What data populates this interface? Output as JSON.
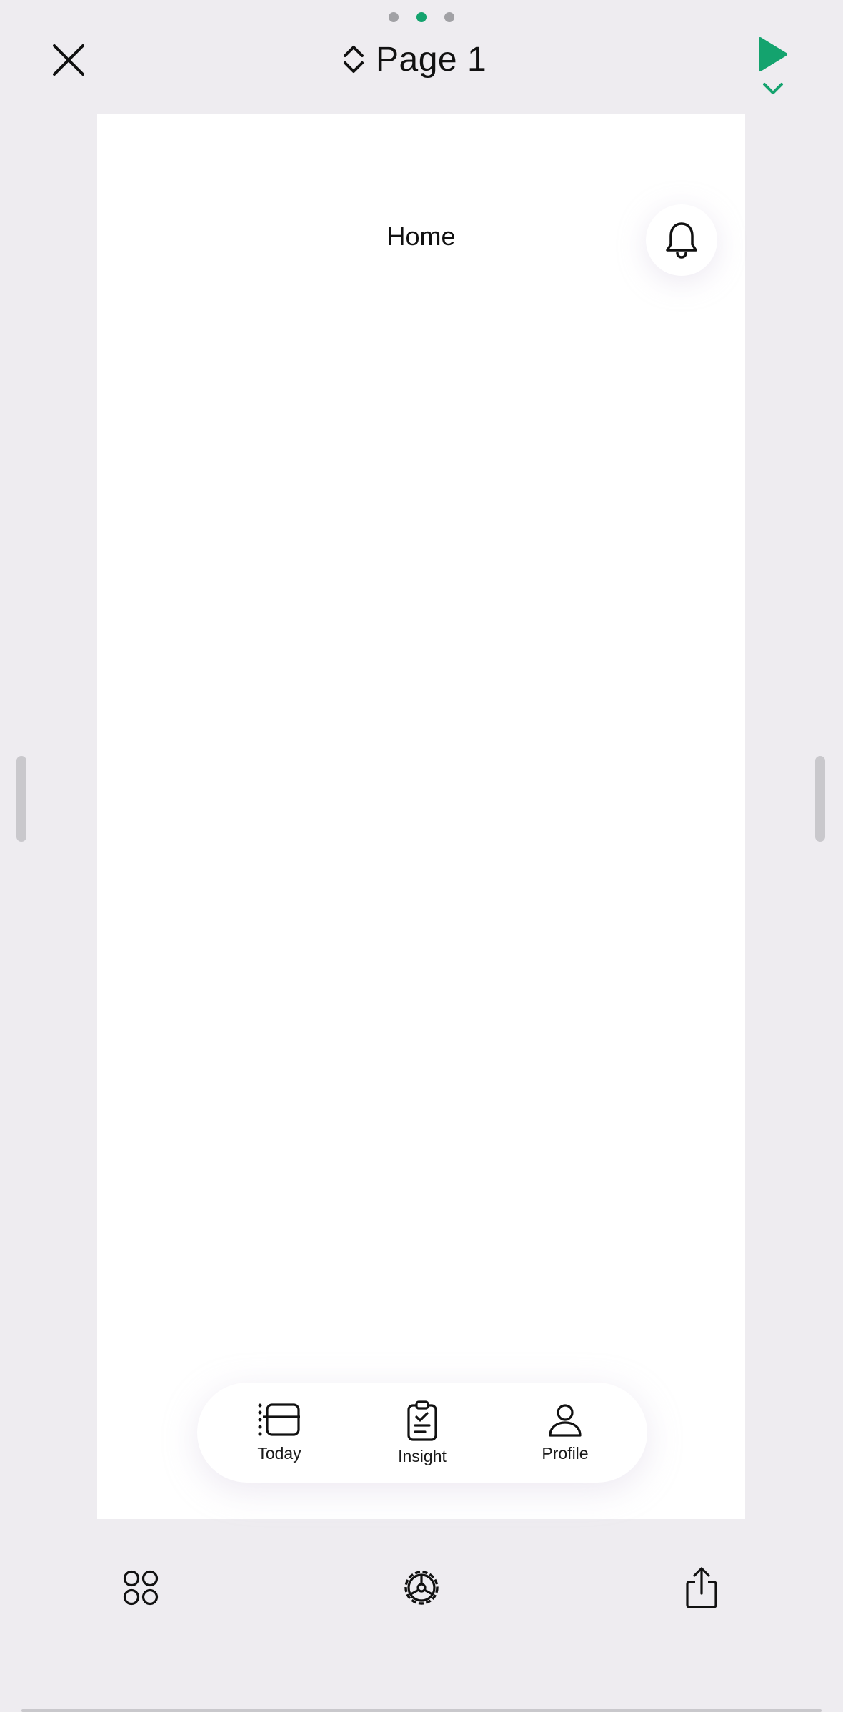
{
  "header": {
    "page_label": "Page 1",
    "page_indicator": [
      "page-1",
      "page-2",
      "page-3"
    ],
    "active_page_index": 1
  },
  "screen": {
    "title": "Home"
  },
  "tab_bar": {
    "items": [
      {
        "label": "Today",
        "icon": "today-list-icon"
      },
      {
        "label": "Insight",
        "icon": "clipboard-icon"
      },
      {
        "label": "Profile",
        "icon": "person-icon"
      }
    ]
  },
  "toolbar": {
    "icons": [
      "apps-grid-icon",
      "settings-gear-icon",
      "share-icon"
    ]
  },
  "colors": {
    "accent": "#14a36e",
    "background": "#eeecf0",
    "canvas": "#ffffff",
    "dot_inactive": "#a1a1a5"
  }
}
